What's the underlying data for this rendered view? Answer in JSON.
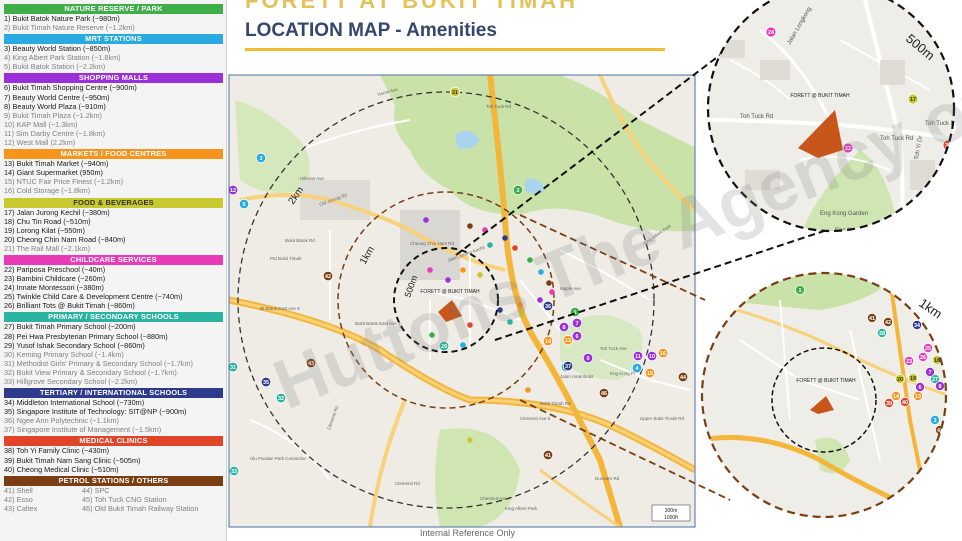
{
  "banner_text": "FORETT AT BUKIT TIMAH",
  "title": "LOCATION MAP - Amenities",
  "footer": "Internal Reference Only",
  "watermark": "Huttons The Agency of Choice",
  "legend": [
    {
      "header": "NATURE RESERVE / PARK",
      "color": "#3fae49",
      "items": [
        {
          "text": "1) Bukit Batok Nature Park (~980m)",
          "near": true
        },
        {
          "text": "2) Bukit Timah Nature Reserve (~1.2km)",
          "near": false
        }
      ]
    },
    {
      "header": "MRT STATIONS",
      "color": "#29abe2",
      "items": [
        {
          "text": "3) Beauty World Station (~850m)",
          "near": true
        },
        {
          "text": "4) King Albert Park Station (~1.8km)",
          "near": false
        },
        {
          "text": "5) Bukit Batok Station (~2.2km)",
          "near": false
        }
      ]
    },
    {
      "header": "SHOPPING MALLS",
      "color": "#9b30d9",
      "items": [
        {
          "text": "6) Bukit Timah Shopping Centre (~900m)",
          "near": true
        },
        {
          "text": "7) Beauty World Centre (~950m)",
          "near": true
        },
        {
          "text": "8) Beauty World Plaza (~910m)",
          "near": true
        },
        {
          "text": "9) Bukit Timah Plaza (~1.2km)",
          "near": false
        },
        {
          "text": "10) KAP Mall (~1.3km)",
          "near": false
        },
        {
          "text": "11) Sim Darby Centre (~1.8km)",
          "near": false
        },
        {
          "text": "12) West Mall (2.2km)",
          "near": false
        }
      ]
    },
    {
      "header": "MARKETS / FOOD CENTRES",
      "color": "#f7941d",
      "items": [
        {
          "text": "13) Bukit Timah Market (~940m)",
          "near": true
        },
        {
          "text": "14) Giant Supermarket (950m)",
          "near": true
        },
        {
          "text": "15) NTUC Fair Price Finest (~1.2km)",
          "near": false
        },
        {
          "text": "16) Cold Storage (~1.8km)",
          "near": false
        }
      ]
    },
    {
      "header": "FOOD & BEVERAGES",
      "color": "#c8c92e",
      "items": [
        {
          "text": "17) Jalan Jurong Kechil (~380m)",
          "near": true
        },
        {
          "text": "18) Chu Tin Road (~510m)",
          "near": true
        },
        {
          "text": "19) Lorong Kilat (~550m)",
          "near": true
        },
        {
          "text": "20) Cheong Chin Nam Road (~840m)",
          "near": true
        },
        {
          "text": "21) The Rail Mall (~2.1km)",
          "near": false
        }
      ]
    },
    {
      "header": "CHILDCARE SERVICES",
      "color": "#e83bb8",
      "items": [
        {
          "text": "22) Pariposa Preschool (~40m)",
          "near": true
        },
        {
          "text": "23) Bambini Childcare (~260m)",
          "near": true
        },
        {
          "text": "24) Innate Montessori (~380m)",
          "near": true
        },
        {
          "text": "25) Twinkle Child Care & Development Centre (~740m)",
          "near": true
        },
        {
          "text": "26) Brilliant Tots @ Bukit Timah (~860m)",
          "near": true
        }
      ]
    },
    {
      "header": "PRIMARY / SECONDARY SCHOOLS",
      "color": "#2ab3a0",
      "items": [
        {
          "text": "27) Bukit Timah Primary School (~200m)",
          "near": true
        },
        {
          "text": "28) Pei Hwa Presbyterian Primary School (~880m)",
          "near": true
        },
        {
          "text": "29) Yusof Ishak Secondary School (~860m)",
          "near": true
        },
        {
          "text": "30) Keming Primary School (~1.4km)",
          "near": false
        },
        {
          "text": "31) Methodist Girls' Primary & Secondary School (~1.7km)",
          "near": false
        },
        {
          "text": "32) Bukit View Primary & Secondary School (~1.7km)",
          "near": false
        },
        {
          "text": "33) Hillgrove Secondary School (~2.2km)",
          "near": false
        }
      ]
    },
    {
      "header": "TERTIARY / INTERNATIONAL SCHOOLS",
      "color": "#2e3a8c",
      "items": [
        {
          "text": "34) Middleton International School (~730m)",
          "near": true
        },
        {
          "text": "35) Singapore Institute of Technology: SIT@NP (~900m)",
          "near": true
        },
        {
          "text": "36) Ngee Ann Polytechnic (~1.1km)",
          "near": false
        },
        {
          "text": "37) Singapore Institute of Management (~1.5km)",
          "near": false
        }
      ]
    },
    {
      "header": "MEDICAL CLINICS",
      "color": "#e0452a",
      "items": [
        {
          "text": "38) Toh Yi Family Clinic (~430m)",
          "near": true
        },
        {
          "text": "39) Bukit Timah Nam Sang Clinic (~505m)",
          "near": true
        },
        {
          "text": "40) Cheong Medical Clinic (~510m)",
          "near": true
        }
      ]
    }
  ],
  "petrol": {
    "header": "PETROL STATIONS / OTHERS",
    "color": "#7a3e12",
    "items": [
      "41) Shell",
      "44) SPC",
      "42) Esso",
      "45) Toh Tuck CNG Station",
      "43) Caltex",
      "46) Old Bukit Timah Railway Station"
    ]
  },
  "main_map": {
    "rings": [
      "2km",
      "1km",
      "500m"
    ],
    "site_label": "FORETT @ BUKIT TIMAH",
    "scale": [
      "300m",
      "1000ft"
    ],
    "roads": [
      "Hume Ave",
      "Toh Tuck Rd",
      "Old Jurong Rd",
      "Bukit Batok Rd",
      "Jalan Jurong Kechil",
      "King Albert Park",
      "Clementi Rd",
      "Dunearn Rd",
      "Bukit Timah Rd",
      "Maple Ave",
      "Toh Tuck Ave",
      "Bukit Batok East Ave 3",
      "Cheong Chin Nam Rd",
      "Eng Kong Pl",
      "Chestnut Ave",
      "Clementi Rd",
      "Jalan Anak Bukit",
      "King Albert Park",
      "Ulu Pandan Park Connector",
      "Hillview Ave",
      "Ptd Bukit Timah",
      "Bt Batok East Ave 6",
      "Clementi Ave 6",
      "Upper Bukit Timah Rd"
    ],
    "markers": [
      {
        "n": "1",
        "c": "#3fae49"
      },
      {
        "n": "2",
        "c": "#3fae49"
      },
      {
        "n": "3",
        "c": "#29abe2"
      },
      {
        "n": "4",
        "c": "#29abe2"
      },
      {
        "n": "5",
        "c": "#29abe2"
      },
      {
        "n": "6",
        "c": "#9b30d9"
      },
      {
        "n": "7",
        "c": "#9b30d9"
      },
      {
        "n": "8",
        "c": "#9b30d9"
      },
      {
        "n": "9",
        "c": "#9b30d9"
      },
      {
        "n": "10",
        "c": "#9b30d9"
      },
      {
        "n": "11",
        "c": "#9b30d9"
      },
      {
        "n": "12",
        "c": "#9b30d9"
      },
      {
        "n": "13",
        "c": "#f7941d"
      },
      {
        "n": "14",
        "c": "#f7941d"
      },
      {
        "n": "15",
        "c": "#f7941d"
      },
      {
        "n": "16",
        "c": "#f7941d"
      },
      {
        "n": "21",
        "c": "#c8c92e"
      },
      {
        "n": "29",
        "c": "#2ab3a0"
      },
      {
        "n": "30",
        "c": "#2ab3a0"
      },
      {
        "n": "31",
        "c": "#2ab3a0"
      },
      {
        "n": "32",
        "c": "#2ab3a0"
      },
      {
        "n": "33",
        "c": "#2ab3a0"
      },
      {
        "n": "35",
        "c": "#2e3a8c"
      },
      {
        "n": "36",
        "c": "#2e3a8c"
      },
      {
        "n": "37",
        "c": "#2e3a8c"
      },
      {
        "n": "41",
        "c": "#7a3e12"
      },
      {
        "n": "42",
        "c": "#7a3e12"
      },
      {
        "n": "43",
        "c": "#7a3e12"
      },
      {
        "n": "44",
        "c": "#7a3e12"
      },
      {
        "n": "46",
        "c": "#7a3e12"
      }
    ],
    "dots": [
      "#e83bb8",
      "#9b30d9",
      "#f7941d",
      "#c8c92e",
      "#2ab3a0",
      "#2e3a8c",
      "#e0452a",
      "#3fae49",
      "#29abe2",
      "#7a3e12"
    ]
  },
  "inset_500": {
    "label": "500m",
    "site_label": "FORETT @ BUKIT TIMAH",
    "roads": [
      "Toh Tuck Rd",
      "Toh Yi Dr",
      "Jalan Lengkong",
      "Toh Tuck Rd",
      "Eng Kong Garden",
      "Eng Kong Ter",
      "Toh Tuck Rd",
      "Tuck Rd"
    ],
    "markers": [
      {
        "n": "24",
        "c": "#e83bb8"
      },
      {
        "n": "17",
        "c": "#c8c92e"
      },
      {
        "n": "22",
        "c": "#e83bb8"
      },
      {
        "n": "38",
        "c": "#e0452a"
      }
    ]
  },
  "inset_1km": {
    "label": "1km",
    "site_label": "FORETT @ BUKIT TIMAH",
    "markers": [
      {
        "n": "1",
        "c": "#3fae49"
      },
      {
        "n": "41",
        "c": "#7a3e12"
      },
      {
        "n": "42",
        "c": "#7a3e12"
      },
      {
        "n": "34",
        "c": "#2e3a8c"
      },
      {
        "n": "28",
        "c": "#2ab3a0"
      },
      {
        "n": "25",
        "c": "#e83bb8"
      },
      {
        "n": "26",
        "c": "#e83bb8"
      },
      {
        "n": "23",
        "c": "#e83bb8"
      },
      {
        "n": "18",
        "c": "#c8c92e"
      },
      {
        "n": "19",
        "c": "#c8c92e"
      },
      {
        "n": "20",
        "c": "#c8c92e"
      },
      {
        "n": "27",
        "c": "#2ab3a0"
      },
      {
        "n": "6",
        "c": "#9b30d9"
      },
      {
        "n": "7",
        "c": "#9b30d9"
      },
      {
        "n": "8",
        "c": "#9b30d9"
      },
      {
        "n": "13",
        "c": "#f7941d"
      },
      {
        "n": "14",
        "c": "#f7941d"
      },
      {
        "n": "3",
        "c": "#29abe2"
      },
      {
        "n": "39",
        "c": "#e0452a"
      },
      {
        "n": "40",
        "c": "#e0452a"
      },
      {
        "n": "43",
        "c": "#7a3e12"
      },
      {
        "n": "35",
        "c": "#2e3a8c"
      }
    ]
  }
}
